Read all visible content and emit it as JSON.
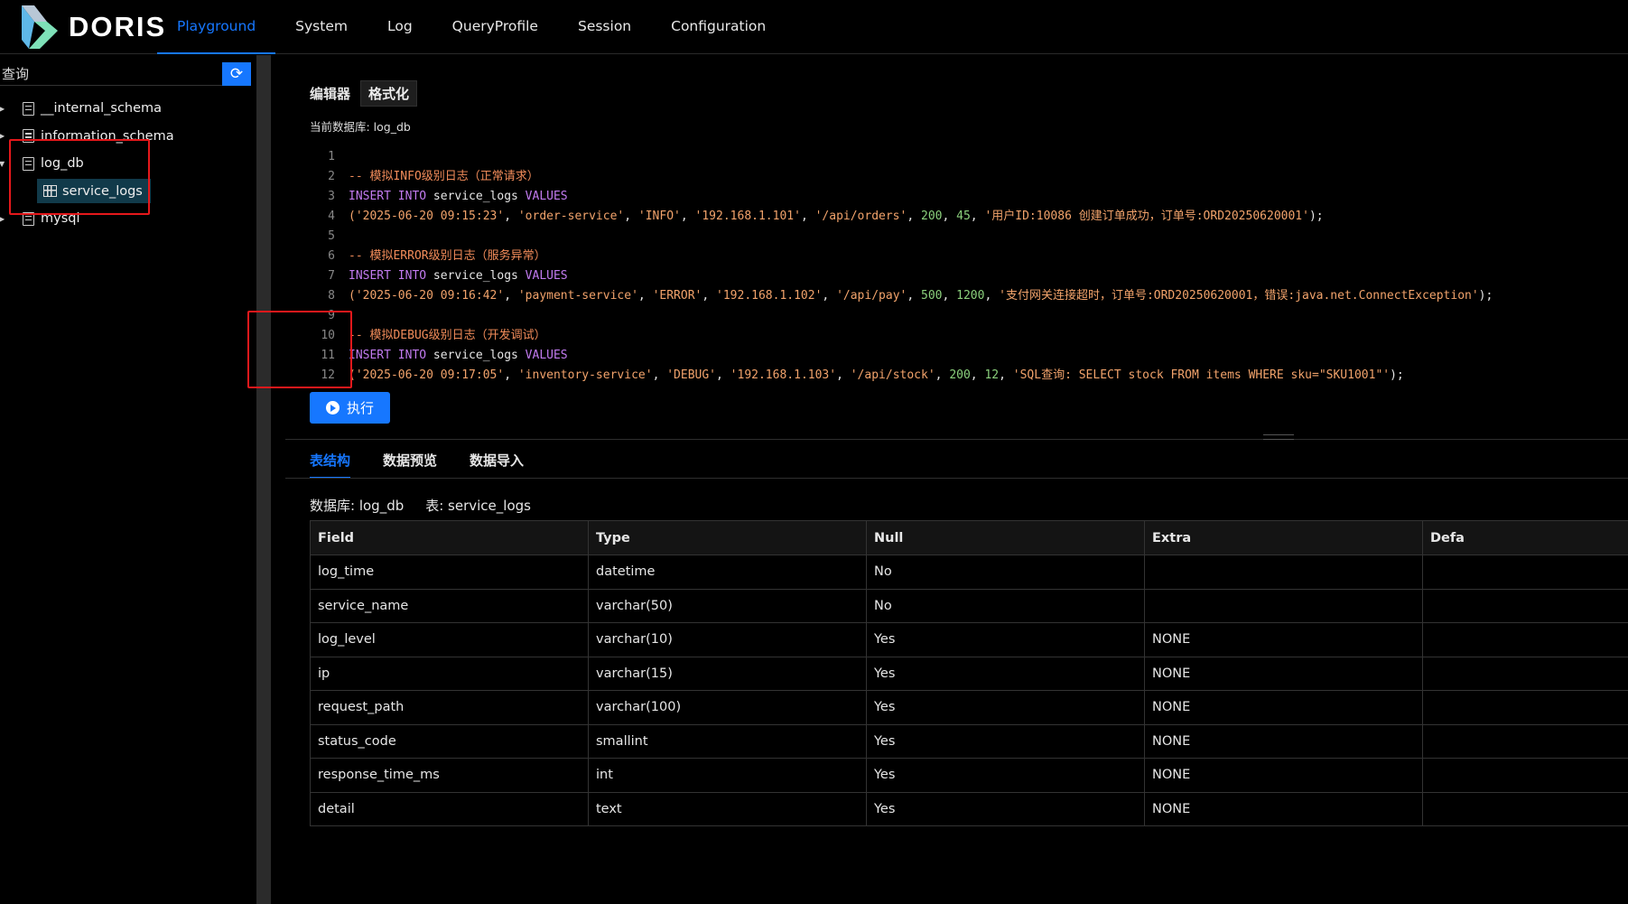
{
  "app": {
    "logo_text": "DORIS"
  },
  "nav": [
    {
      "label": "Playground",
      "active": true
    },
    {
      "label": "System"
    },
    {
      "label": "Log"
    },
    {
      "label": "QueryProfile"
    },
    {
      "label": "Session"
    },
    {
      "label": "Configuration"
    }
  ],
  "sidebar": {
    "search_placeholder": "查询",
    "tree": [
      {
        "label": "__internal_schema"
      },
      {
        "label": "information_schema"
      },
      {
        "label": "log_db",
        "expanded": true,
        "children": [
          {
            "label": "service_logs"
          }
        ]
      },
      {
        "label": "mysql"
      }
    ]
  },
  "editor": {
    "title": "编辑器",
    "format_label": "格式化",
    "current_db": "当前数据库: log_db",
    "lines": [
      {
        "n": "1",
        "tokens": []
      },
      {
        "n": "2",
        "tokens": [
          {
            "t": "comment",
            "v": "-- 模拟INFO级别日志（正常请求）"
          }
        ]
      },
      {
        "n": "3",
        "tokens": [
          {
            "t": "kw",
            "v": "INSERT INTO "
          },
          {
            "t": "plain",
            "v": "service_logs "
          },
          {
            "t": "kw",
            "v": "VALUES"
          }
        ]
      },
      {
        "n": "4",
        "tokens": [
          {
            "t": "str",
            "v": "('2025-06-20 09:15:23'"
          },
          {
            "t": "plain",
            "v": ", "
          },
          {
            "t": "str",
            "v": "'order-service'"
          },
          {
            "t": "plain",
            "v": ", "
          },
          {
            "t": "str",
            "v": "'INFO'"
          },
          {
            "t": "plain",
            "v": ", "
          },
          {
            "t": "str",
            "v": "'192.168.1.101'"
          },
          {
            "t": "plain",
            "v": ", "
          },
          {
            "t": "str",
            "v": "'/api/orders'"
          },
          {
            "t": "plain",
            "v": ", "
          },
          {
            "t": "num",
            "v": "200"
          },
          {
            "t": "plain",
            "v": ", "
          },
          {
            "t": "num",
            "v": "45"
          },
          {
            "t": "plain",
            "v": ", "
          },
          {
            "t": "str",
            "v": "'用户ID:10086 创建订单成功，订单号:ORD20250620001'"
          },
          {
            "t": "plain",
            "v": ");"
          }
        ]
      },
      {
        "n": "5",
        "tokens": []
      },
      {
        "n": "6",
        "tokens": [
          {
            "t": "comment",
            "v": "-- 模拟ERROR级别日志（服务异常）"
          }
        ]
      },
      {
        "n": "7",
        "tokens": [
          {
            "t": "kw",
            "v": "INSERT INTO "
          },
          {
            "t": "plain",
            "v": "service_logs "
          },
          {
            "t": "kw",
            "v": "VALUES"
          }
        ]
      },
      {
        "n": "8",
        "tokens": [
          {
            "t": "str",
            "v": "('2025-06-20 09:16:42'"
          },
          {
            "t": "plain",
            "v": ", "
          },
          {
            "t": "str",
            "v": "'payment-service'"
          },
          {
            "t": "plain",
            "v": ", "
          },
          {
            "t": "str",
            "v": "'ERROR'"
          },
          {
            "t": "plain",
            "v": ", "
          },
          {
            "t": "str",
            "v": "'192.168.1.102'"
          },
          {
            "t": "plain",
            "v": ", "
          },
          {
            "t": "str",
            "v": "'/api/pay'"
          },
          {
            "t": "plain",
            "v": ", "
          },
          {
            "t": "num",
            "v": "500"
          },
          {
            "t": "plain",
            "v": ", "
          },
          {
            "t": "num",
            "v": "1200"
          },
          {
            "t": "plain",
            "v": ", "
          },
          {
            "t": "str",
            "v": "'支付网关连接超时，订单号:ORD20250620001，错误:java.net.ConnectException'"
          },
          {
            "t": "plain",
            "v": ");"
          }
        ]
      },
      {
        "n": "9",
        "tokens": []
      },
      {
        "n": "10",
        "tokens": [
          {
            "t": "comment",
            "v": "-- 模拟DEBUG级别日志（开发调试）"
          }
        ]
      },
      {
        "n": "11",
        "tokens": [
          {
            "t": "kw",
            "v": "INSERT INTO "
          },
          {
            "t": "plain",
            "v": "service_logs "
          },
          {
            "t": "kw",
            "v": "VALUES"
          }
        ]
      },
      {
        "n": "12",
        "tokens": [
          {
            "t": "str",
            "v": "('2025-06-20 09:17:05'"
          },
          {
            "t": "plain",
            "v": ", "
          },
          {
            "t": "str",
            "v": "'inventory-service'"
          },
          {
            "t": "plain",
            "v": ", "
          },
          {
            "t": "str",
            "v": "'DEBUG'"
          },
          {
            "t": "plain",
            "v": ", "
          },
          {
            "t": "str",
            "v": "'192.168.1.103'"
          },
          {
            "t": "plain",
            "v": ", "
          },
          {
            "t": "str",
            "v": "'/api/stock'"
          },
          {
            "t": "plain",
            "v": ", "
          },
          {
            "t": "num",
            "v": "200"
          },
          {
            "t": "plain",
            "v": ", "
          },
          {
            "t": "num",
            "v": "12"
          },
          {
            "t": "plain",
            "v": ", "
          },
          {
            "t": "str",
            "v": "'SQL查询: SELECT stock FROM items WHERE sku=\"SKU1001\"'"
          },
          {
            "t": "plain",
            "v": ");"
          }
        ]
      }
    ],
    "run_label": "执行"
  },
  "tabs": [
    {
      "label": "表结构",
      "active": true
    },
    {
      "label": "数据预览"
    },
    {
      "label": "数据导入"
    }
  ],
  "table_info": {
    "database": "数据库: log_db",
    "table": "表: service_logs"
  },
  "schema": {
    "columns": [
      "Field",
      "Type",
      "Null",
      "Extra",
      "Defa"
    ],
    "rows": [
      [
        "log_time",
        "datetime",
        "No",
        "",
        ""
      ],
      [
        "service_name",
        "varchar(50)",
        "No",
        "",
        ""
      ],
      [
        "log_level",
        "varchar(10)",
        "Yes",
        "NONE",
        ""
      ],
      [
        "ip",
        "varchar(15)",
        "Yes",
        "NONE",
        ""
      ],
      [
        "request_path",
        "varchar(100)",
        "Yes",
        "NONE",
        ""
      ],
      [
        "status_code",
        "smallint",
        "Yes",
        "NONE",
        ""
      ],
      [
        "response_time_ms",
        "int",
        "Yes",
        "NONE",
        ""
      ],
      [
        "detail",
        "text",
        "Yes",
        "NONE",
        ""
      ]
    ]
  },
  "colors": {
    "accent": "#1677ff",
    "annotation_red": "#e5181b",
    "background": "#000000"
  },
  "icons": [
    "doris-logo-icon",
    "refresh-icon",
    "database-icon",
    "table-icon",
    "play-icon"
  ]
}
